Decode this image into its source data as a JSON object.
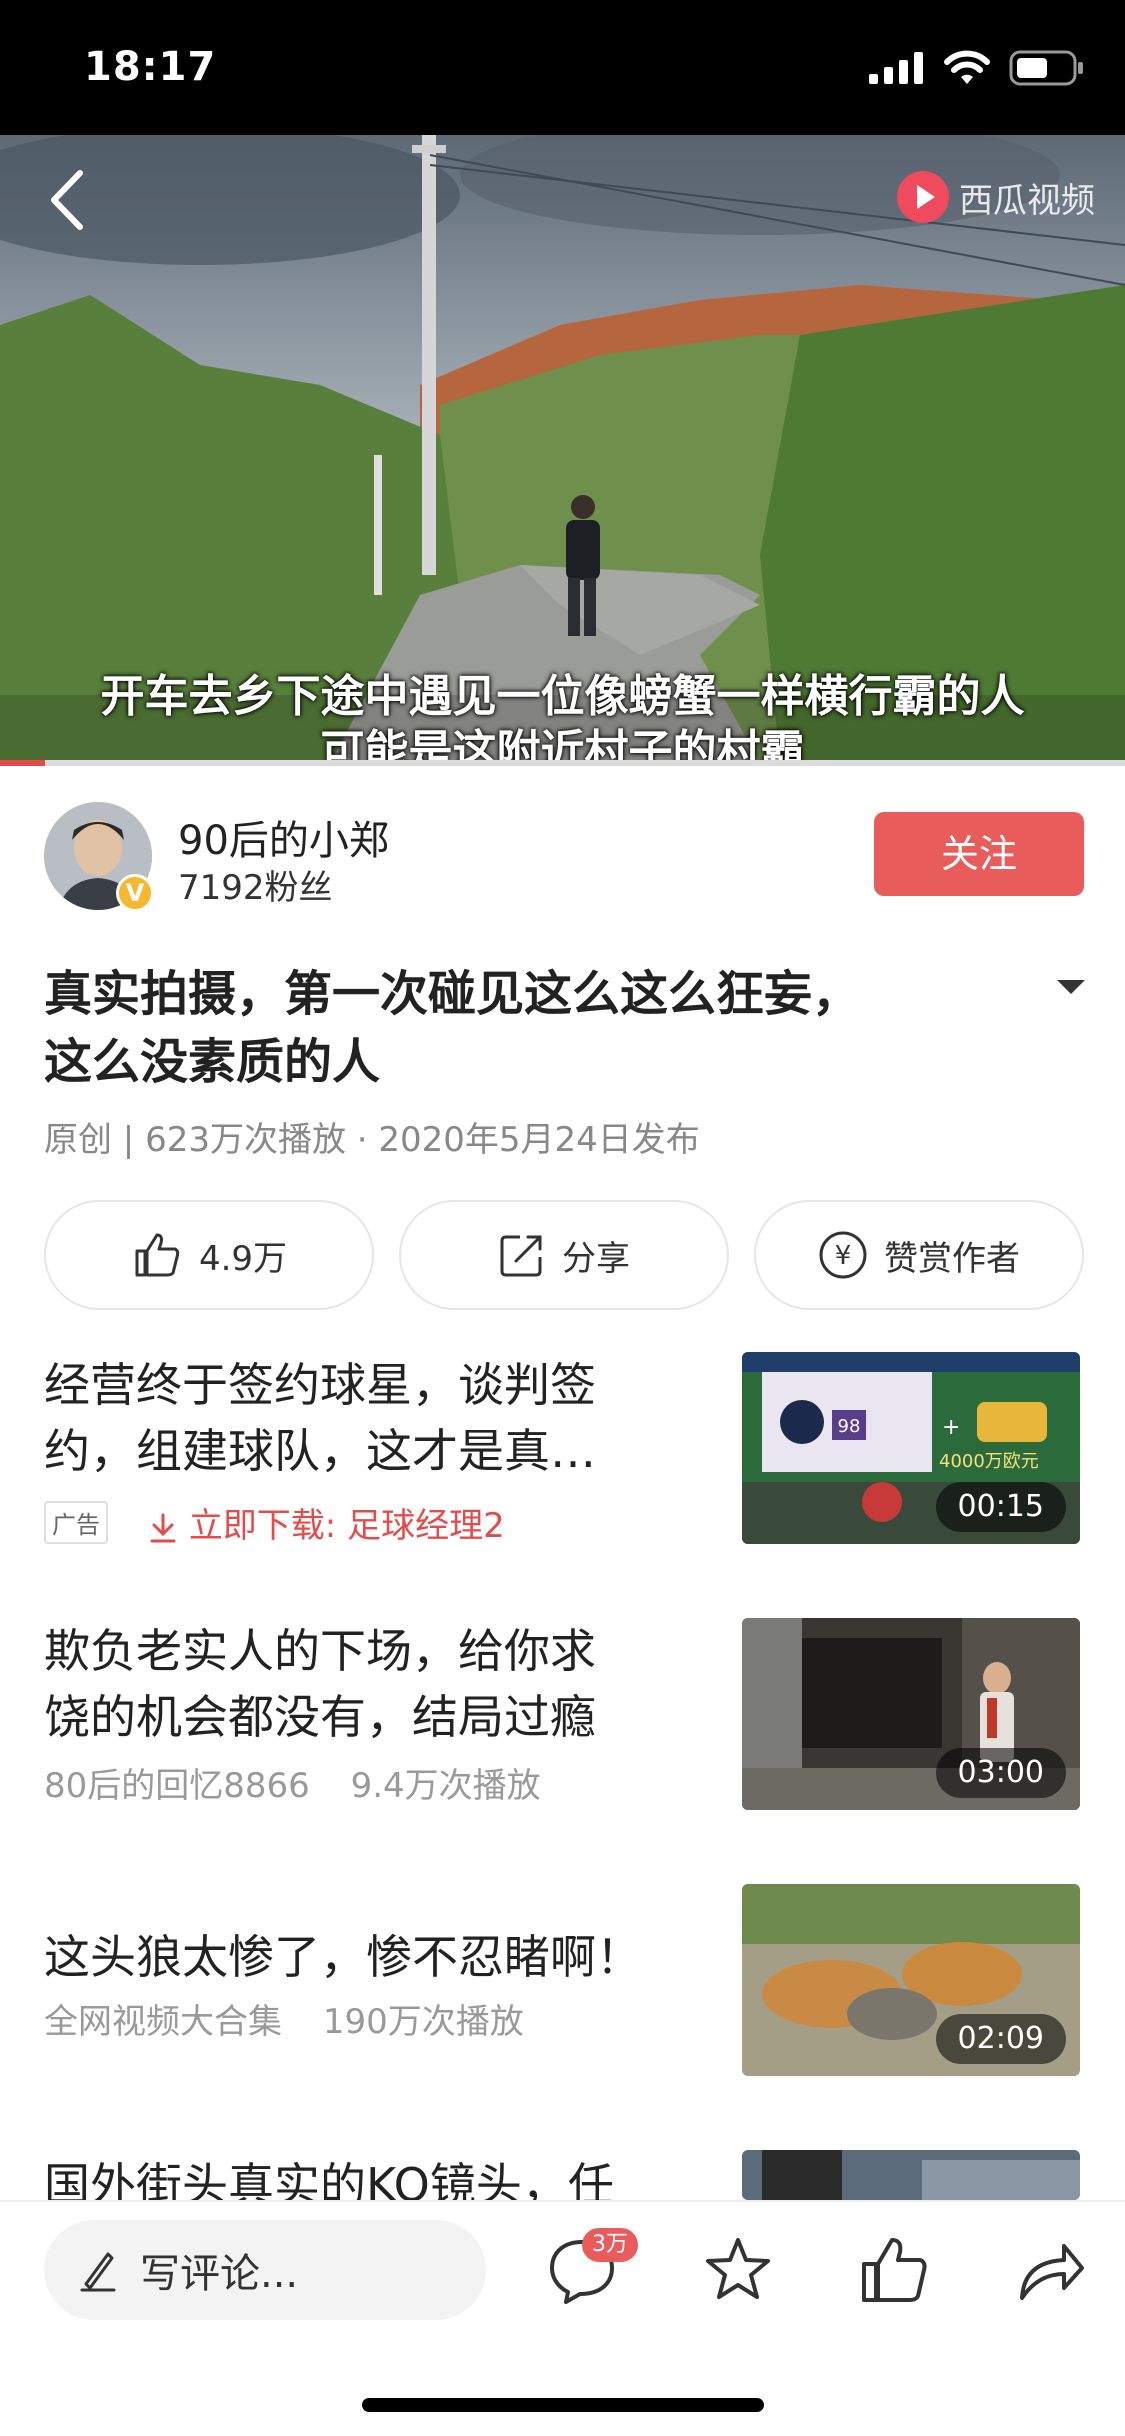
{
  "status_bar": {
    "time": "18:17"
  },
  "video": {
    "logo_text": "西瓜视频",
    "subtitle_line1": "开车去乡下途中遇见一位像螃蟹一样横行霸的人",
    "subtitle_line2": "可能是这附近村子的村霸",
    "progress": 0.04
  },
  "author": {
    "name": "90后的小郑",
    "fans": "7192粉丝",
    "verified_badge": "V",
    "follow_label": "关注"
  },
  "article": {
    "title_line1": "真实拍摄，第一次碰见这么这么狂妄，",
    "title_line2": "这么没素质的人",
    "meta": "原创 | 623万次播放 · 2020年5月24日发布"
  },
  "actions": {
    "like_label": "4.9万",
    "share_label": "分享",
    "reward_label": "赞赏作者",
    "reward_symbol": "¥"
  },
  "recommendations": [
    {
      "title_line1": "经营终于签约球星，谈判签",
      "title_line2": "约，组建球队，这才是真…",
      "ad_badge": "广告",
      "ad_link": "立即下载: 足球经理2",
      "duration": "00:15",
      "thumb_text": "4000万欧元",
      "thumb_rating": "98"
    },
    {
      "title_line1": "欺负老实人的下场，给你求",
      "title_line2": "饶的机会都没有，结局过瘾",
      "source": "80后的回忆8866",
      "plays": "9.4万次播放",
      "duration": "03:00"
    },
    {
      "title_line1": "这头狼太惨了，惨不忍睹啊！",
      "source": "全网视频大合集",
      "plays": "190万次播放",
      "duration": "02:09"
    },
    {
      "title_line1": "国外街头真实的KO镜头，任"
    }
  ],
  "bottom_bar": {
    "comment_placeholder": "写评论...",
    "comment_count": "3万"
  },
  "colors": {
    "accent": "#e85c5c",
    "badge_gold": "#f5b82e"
  }
}
